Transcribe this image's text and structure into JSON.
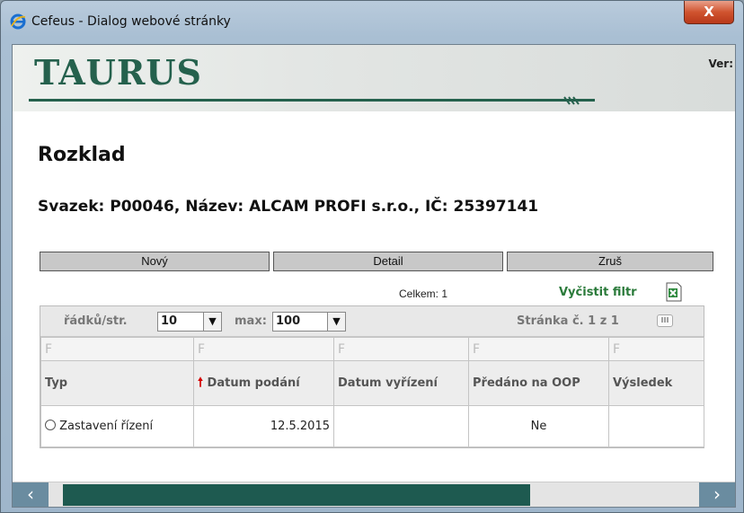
{
  "window": {
    "title": "Cefeus - Dialog webové stránky",
    "close_label": "X"
  },
  "banner": {
    "logo": "TAURUS",
    "version_label": "Ver:"
  },
  "page": {
    "heading": "Rozklad",
    "subheading": "Svazek: P00046, Název: ALCAM PROFI s.r.o., IČ: 25397141"
  },
  "buttons": {
    "new": "Nový",
    "detail": "Detail",
    "cancel": "Zruš"
  },
  "summary": {
    "total": "Celkem: 1",
    "clear_filter": "Vyčistit filtr"
  },
  "pager": {
    "rows_label": "řádků/str.",
    "rows_value": "10",
    "max_label": "max:",
    "max_value": "100",
    "page_info": "Stránka č. 1 z 1"
  },
  "table": {
    "filter_marker": "F",
    "headers": [
      "Typ",
      "Datum podání",
      "Datum vyřízení",
      "Předáno na OOP",
      "Výsledek"
    ],
    "rows": [
      {
        "typ": "Zastavení řízení",
        "datum_podani": "12.5.2015",
        "datum_vyrizeni": "",
        "predano": "Ne",
        "vysledek": ""
      }
    ]
  },
  "colors": {
    "brand": "#25614d",
    "sort_arrow": "#d40000",
    "link": "#2a7a3a"
  }
}
